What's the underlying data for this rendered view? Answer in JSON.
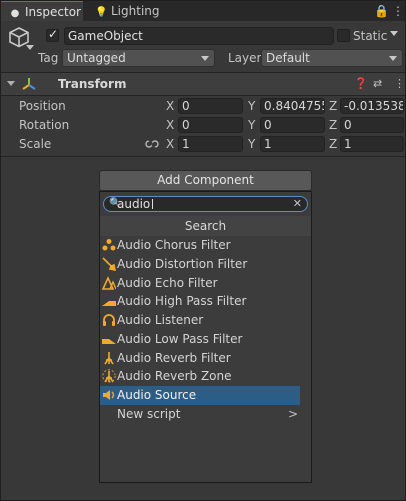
{
  "tabs": [
    {
      "label": "Inspector",
      "icon": "info-icon",
      "active": true
    },
    {
      "label": "Lighting",
      "icon": "bulb-icon",
      "active": false
    }
  ],
  "header": {
    "object_name": "GameObject",
    "active": true,
    "static_label": "Static",
    "static_checked": false,
    "tag_label": "Tag",
    "tag_value": "Untagged",
    "layer_label": "Layer",
    "layer_value": "Default"
  },
  "transform": {
    "title": "Transform",
    "rows": [
      {
        "label": "Position",
        "x": "0",
        "y": "0.8404755",
        "z": "-0.013538"
      },
      {
        "label": "Rotation",
        "x": "0",
        "y": "0",
        "z": "0"
      },
      {
        "label": "Scale",
        "x": "1",
        "y": "1",
        "z": "1"
      }
    ],
    "axes": [
      "X",
      "Y",
      "Z"
    ]
  },
  "add_component": {
    "button_label": "Add Component",
    "search_value": "audio",
    "search_header": "Search",
    "items": [
      {
        "label": "Audio Chorus Filter",
        "icon": "audio-chorus-filter-icon"
      },
      {
        "label": "Audio Distortion Filter",
        "icon": "audio-distortion-filter-icon"
      },
      {
        "label": "Audio Echo Filter",
        "icon": "audio-echo-filter-icon"
      },
      {
        "label": "Audio High Pass Filter",
        "icon": "audio-high-pass-filter-icon"
      },
      {
        "label": "Audio Listener",
        "icon": "headphones-icon"
      },
      {
        "label": "Audio Low Pass Filter",
        "icon": "audio-low-pass-filter-icon"
      },
      {
        "label": "Audio Reverb Filter",
        "icon": "audio-reverb-filter-icon"
      },
      {
        "label": "Audio Reverb Zone",
        "icon": "audio-reverb-zone-icon"
      },
      {
        "label": "Audio Source",
        "icon": "speaker-icon",
        "selected": true
      },
      {
        "label": "New script",
        "submenu": true
      }
    ]
  },
  "colors": {
    "accent": "#3a79bb",
    "selection": "#2c5d87",
    "icon_orange": "#f0a92c"
  }
}
